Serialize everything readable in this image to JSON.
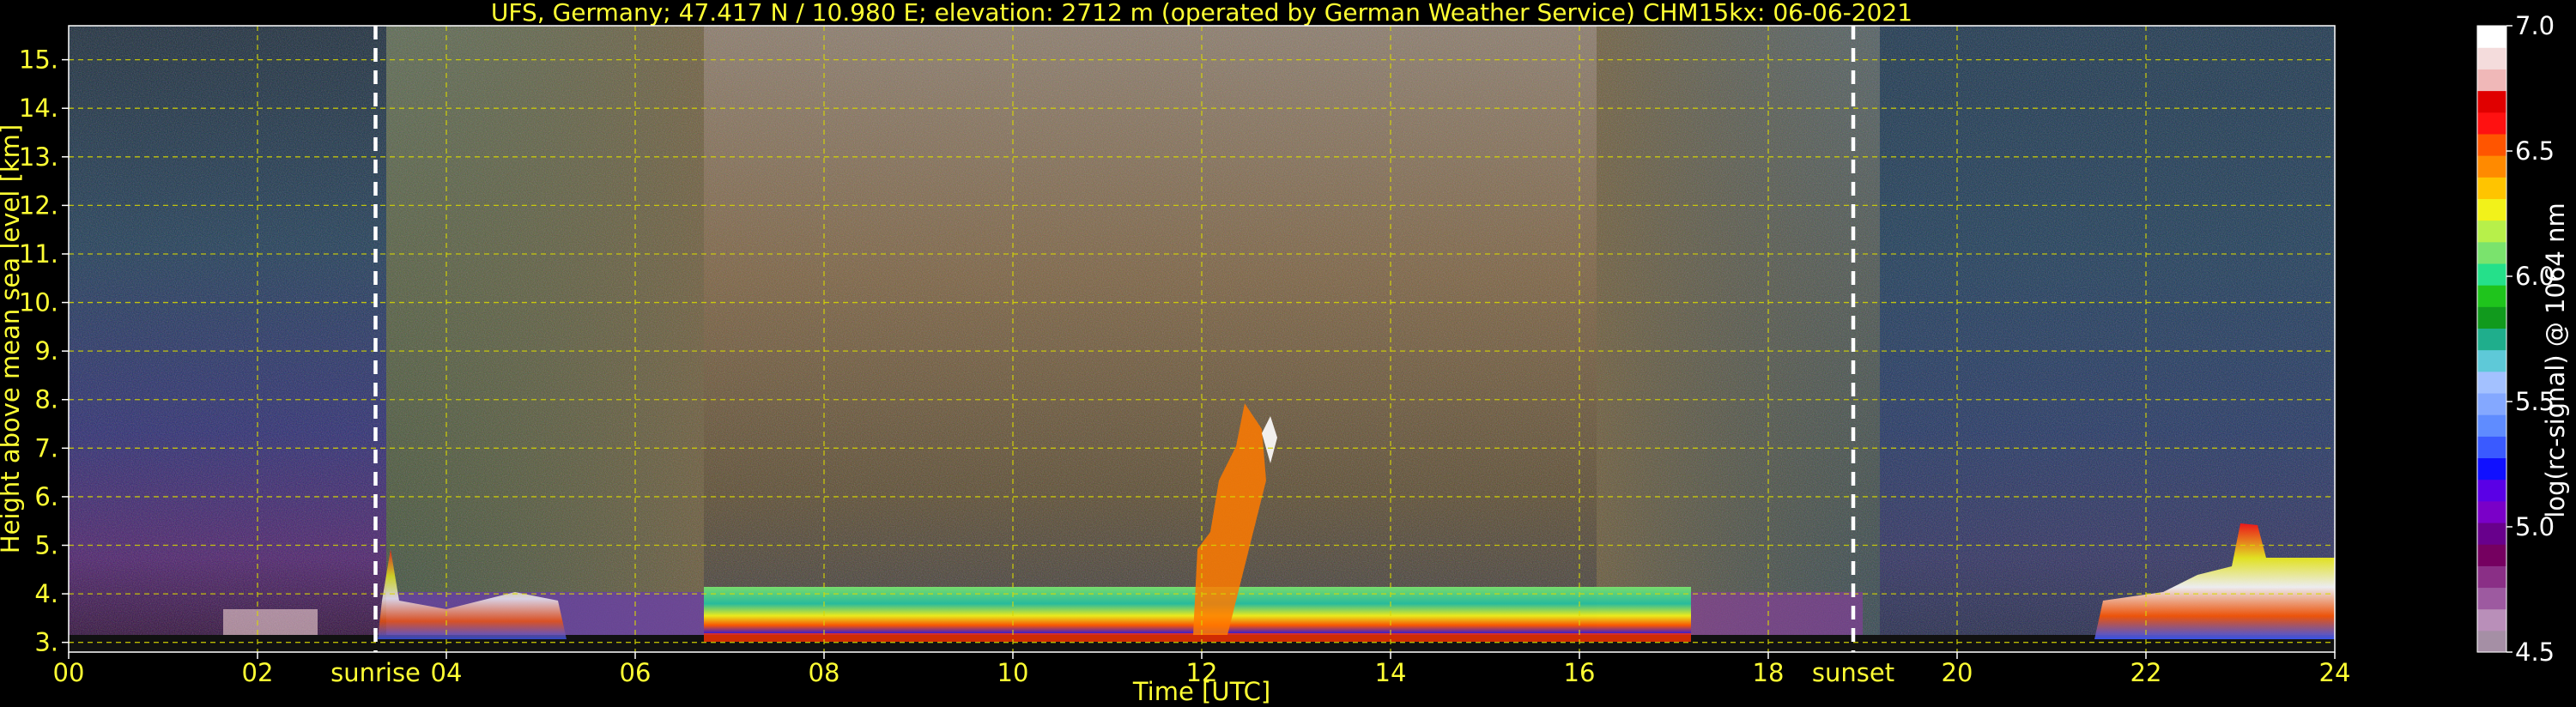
{
  "chart_data": {
    "type": "heatmap",
    "title": "UFS, Germany; 47.417 N / 10.980 E; elevation: 2712 m  (operated by German Weather Service)    CHM15kx: 06-06-2021",
    "xlabel": "Time [UTC]",
    "ylabel": "Height above mean sea level [km]",
    "x_ticks": [
      "00",
      "02",
      "04",
      "06",
      "08",
      "10",
      "12",
      "14",
      "16",
      "18",
      "20",
      "22",
      "24"
    ],
    "y_ticks": [
      "3.",
      "4.",
      "5.",
      "6.",
      "7.",
      "8.",
      "9.",
      "10.",
      "11.",
      "12.",
      "13.",
      "14.",
      "15."
    ],
    "xlim": [
      0,
      24
    ],
    "ylim": [
      2.8,
      15.7
    ],
    "grid": true,
    "annotations": [
      {
        "text": "sunrise",
        "x": 3.25
      },
      {
        "text": "sunset",
        "x": 18.9
      }
    ],
    "colorbar": {
      "label": "log(rc-signal) @ 1064 nm",
      "ticks": [
        "4.5",
        "5.0",
        "5.5",
        "6.0",
        "6.5",
        "7.0"
      ],
      "range": [
        4.5,
        7.0
      ],
      "colors": [
        "#a58fa5",
        "#b98fb9",
        "#9d5aa0",
        "#8a2f86",
        "#750060",
        "#68008c",
        "#7a00c8",
        "#5a00e6",
        "#1010ff",
        "#3a5aff",
        "#5f8cff",
        "#84a8ff",
        "#a3c1ff",
        "#5ec9d8",
        "#1fae8c",
        "#119a1d",
        "#1fc41c",
        "#25e08a",
        "#7ae36d",
        "#b7f04a",
        "#f2f21a",
        "#ffc400",
        "#ff8a00",
        "#ff5500",
        "#ff1111",
        "#e00000",
        "#f0b8b8",
        "#f4dcdc",
        "#ffffff"
      ]
    },
    "signal_features": [
      {
        "name": "boundary layer aerosol",
        "x_start": 6.6,
        "x_end": 17.2,
        "y_top": 4.0,
        "value": 6.2
      },
      {
        "name": "low cloud",
        "x_start": 21.5,
        "x_end": 24,
        "y_top": 5.3,
        "value": 6.6
      },
      {
        "name": "convective plume",
        "x_start": 11.8,
        "x_end": 12.9,
        "y_top": 8.0,
        "value": 6.8
      }
    ]
  }
}
